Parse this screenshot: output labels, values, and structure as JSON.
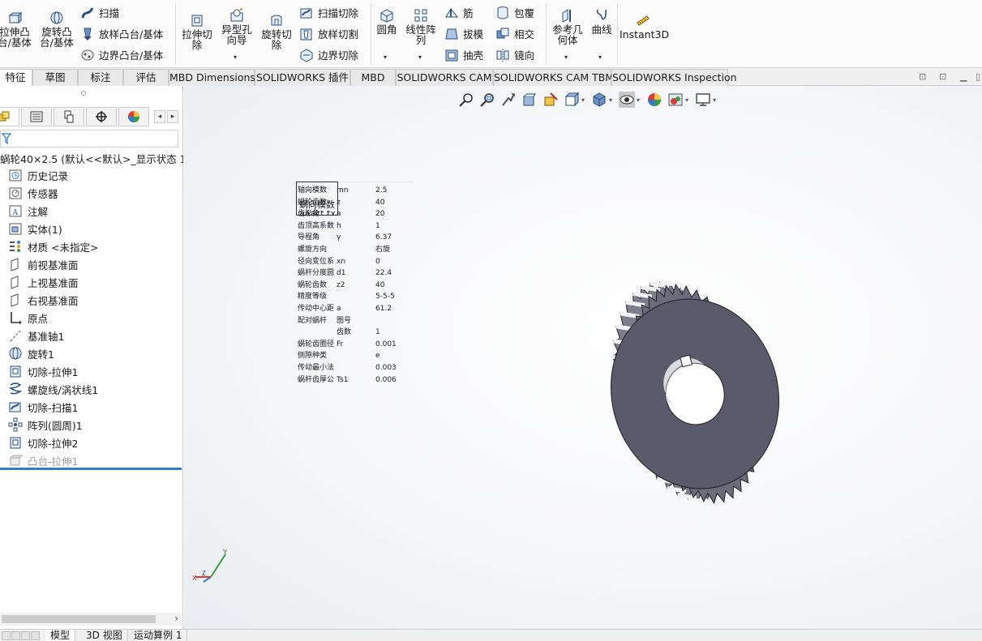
{
  "ribbon": {
    "extrude_boss": "拉伸凸\n台/基体",
    "revolve_boss": "旋转凸\n台/基体",
    "sweep": "扫描",
    "loft_boss": "放样凸台/基体",
    "boundary_boss": "边界凸台/基体",
    "extrude_cut": "拉伸切\n除",
    "hole_wizard": "异型孔\n向导",
    "revolve_cut": "旋转切\n除",
    "sweep_cut": "扫描切除",
    "loft_cut": "放样切割",
    "boundary_cut": "边界切除",
    "fillet": "圆角",
    "linear_pattern": "线性阵\n列",
    "rib": "筋",
    "draft": "拔模",
    "shell": "抽壳",
    "wrap": "包覆",
    "intersect": "相交",
    "mirror": "镜向",
    "reference_geometry": "参考几\n何体",
    "curves": "曲线",
    "instant3d": "Instant3D"
  },
  "tabs": [
    "特征",
    "草图",
    "标注",
    "评估",
    "MBD Dimensions",
    "SOLIDWORKS 插件",
    "MBD",
    "SOLIDWORKS CAM",
    "SOLIDWORKS CAM TBM",
    "SOLIDWORKS Inspection"
  ],
  "tree": {
    "root": "蜗轮40×2.5  (默认<<默认>_显示状态 1",
    "items": [
      {
        "label": "历史记录",
        "icon": "history-icon"
      },
      {
        "label": "传感器",
        "icon": "sensor-icon"
      },
      {
        "label": "注解",
        "icon": "annotation-icon"
      },
      {
        "label": "实体(1)",
        "icon": "solid-bodies-icon"
      },
      {
        "label": "材质 <未指定>",
        "icon": "material-icon"
      },
      {
        "label": "前视基准面",
        "icon": "plane-icon"
      },
      {
        "label": "上视基准面",
        "icon": "plane-icon"
      },
      {
        "label": "右视基准面",
        "icon": "plane-icon"
      },
      {
        "label": "原点",
        "icon": "origin-icon"
      },
      {
        "label": "基准轴1",
        "icon": "axis-icon"
      },
      {
        "label": "旋转1",
        "icon": "revolve-icon"
      },
      {
        "label": "切除-拉伸1",
        "icon": "extrude-cut-icon"
      },
      {
        "label": "螺旋线/涡状线1",
        "icon": "helix-icon"
      },
      {
        "label": "切除-扫描1",
        "icon": "sweep-cut-icon"
      },
      {
        "label": "阵列(圆周)1",
        "icon": "circular-pattern-icon"
      },
      {
        "label": "切除-拉伸2",
        "icon": "extrude-cut-icon"
      },
      {
        "label": "凸台-拉伸1",
        "icon": "extrude-boss-icon"
      }
    ]
  },
  "param_table": {
    "rows": [
      [
        "轴向模数",
        "mn",
        "2.5"
      ],
      [
        "蜗轮齿数",
        "z",
        "40"
      ],
      [
        "齿形角",
        "a",
        "20"
      ],
      [
        "齿顶高系数",
        "h",
        "1"
      ],
      [
        "导程角",
        "γ",
        "6.37"
      ],
      [
        "螺旋方向",
        "",
        "右旋"
      ],
      [
        "径向变位系",
        "xn",
        "0"
      ],
      [
        "蜗杆分度圆",
        "d1",
        "22.4"
      ],
      [
        "蜗轮齿数",
        "z2",
        "40"
      ],
      [
        "精度等级",
        "",
        "5-5-5"
      ],
      [
        "传动中心距",
        "a",
        "61.2"
      ],
      [
        "配对蜗杆",
        "图号",
        ""
      ],
      [
        "",
        "齿数",
        "1"
      ],
      [
        "蜗轮齿圈径",
        "Fr",
        "0.001"
      ],
      [
        "侧隙种类",
        "",
        "e"
      ],
      [
        "传动最小法",
        "",
        "0.003"
      ],
      [
        "蜗杆齿厚公",
        "Ts1",
        "0.006"
      ]
    ],
    "note": "蜗向模数\naaact.tx"
  },
  "bottom_tabs": [
    "模型",
    "3D 视图",
    "运动算例 1"
  ],
  "colors": {
    "gear": "#5a5a6a",
    "accent": "#2f7ccf"
  }
}
